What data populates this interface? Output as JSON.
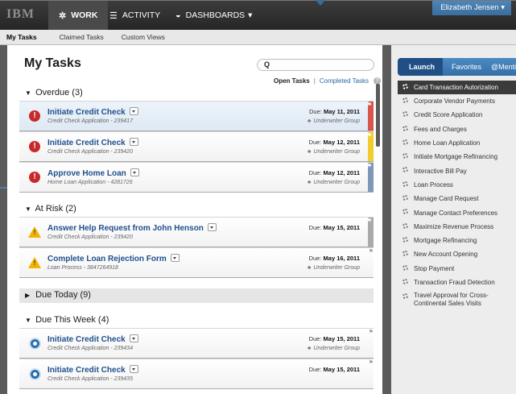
{
  "topbar": {
    "logo": "IBM",
    "nav": [
      {
        "label": "WORK",
        "icon": "gear-icon"
      },
      {
        "label": "ACTIVITY",
        "icon": "list-icon"
      },
      {
        "label": "DASHBOARDS",
        "icon": "gauge-icon",
        "caret": "▾"
      }
    ],
    "user": "Elizabeth Jensen ▾"
  },
  "subnav": [
    "My Tasks",
    "Claimed Tasks",
    "Custom Views"
  ],
  "main": {
    "title": "My Tasks",
    "search_placeholder": "",
    "filters": {
      "open": "Open Tasks",
      "sep": "|",
      "completed": "Completed Tasks",
      "help": "?"
    },
    "sections": [
      {
        "label": "Overdue (3)",
        "tri": "▼"
      },
      {
        "label": "At Risk (2)",
        "tri": "▼"
      },
      {
        "label": "Due Today (9)",
        "tri": "▶"
      },
      {
        "label": "Due This Week (4)",
        "tri": "▼"
      }
    ],
    "tasks": [
      {
        "title": "Initiate Credit Check",
        "sub": "Credit Check Application - 239417",
        "due_label": "Due:",
        "due": "May 11, 2011",
        "group": "Underwriter Group",
        "icon": "error-icon",
        "flag": "#d9544a"
      },
      {
        "title": "Initiate Credit Check",
        "sub": "Credit Check Application - 239420",
        "due_label": "Due:",
        "due": "May 12, 2011",
        "group": "Underwriter Group",
        "icon": "error-icon",
        "flag": "#f2cc2c"
      },
      {
        "title": "Approve Home Loan",
        "sub": "Home Loan Application - 4281726",
        "due_label": "Due:",
        "due": "May 12, 2011",
        "group": "Underwriter Group",
        "icon": "error-icon",
        "flag": "#7f97b8"
      },
      {
        "title": "Answer Help Request from John Henson",
        "sub": "Credit Check Application - 239420",
        "due_label": "Due:",
        "due": "May 15, 2011",
        "group": "",
        "icon": "warning-icon",
        "flag": "#aaaaaa"
      },
      {
        "title": "Complete Loan Rejection Form",
        "sub": "Loan Process - 3847264918",
        "due_label": "Due:",
        "due": "May 16, 2011",
        "group": "Underwriter Group",
        "icon": "warning-icon",
        "flag": ""
      },
      {
        "title": "Initiate Credit Check",
        "sub": "Credit Check Application - 239434",
        "due_label": "Due:",
        "due": "May 15, 2011",
        "group": "Underwriter Group",
        "icon": "clock-icon",
        "flag": ""
      },
      {
        "title": "Initiate Credit Check",
        "sub": "Credit Check Application - 239435",
        "due_label": "Due:",
        "due": "May 15, 2011",
        "group": "",
        "icon": "clock-icon",
        "flag": ""
      }
    ]
  },
  "right": {
    "tabs": [
      "Launch",
      "Favorites",
      "@Mentions"
    ],
    "items": [
      "Card Transaction Autorization",
      "Corporate Vendor Payments",
      "Credit Score Application",
      "Fees and Charges",
      "Home Loan Application",
      "Initiate Mortgage Refinancing",
      "Interactive Bill Pay",
      "Loan Process",
      "Manage Card Request",
      "Manage Contact Preferences",
      "Maximize Revenue Process",
      "Mortgage Refinancing",
      "New Account Opening",
      "Stop Payment",
      "Transaction Fraud Detection",
      "Travel Approval for Cross-Continental Sales Visits"
    ]
  }
}
